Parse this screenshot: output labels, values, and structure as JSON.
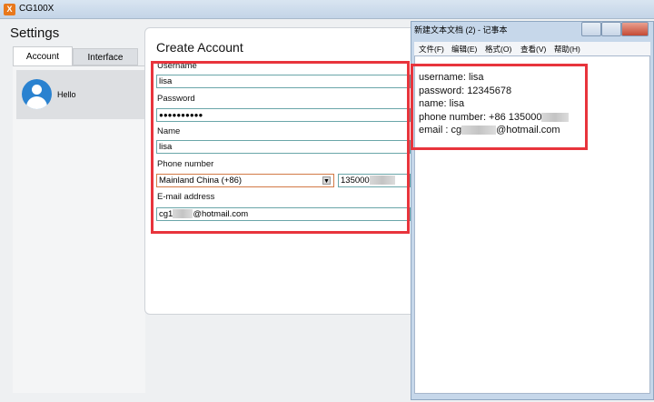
{
  "main": {
    "app_title": "CG100X",
    "logo_glyph": "X",
    "settings_title": "Settings",
    "tabs": [
      {
        "label": "Account"
      },
      {
        "label": "Interface"
      }
    ],
    "account_name": "Hello",
    "accent_color": "#2a82d0"
  },
  "form": {
    "title": "Create Account",
    "username_label": "Username",
    "username_value": "lisa",
    "password_label": "Password",
    "password_value": "●●●●●●●●●●",
    "name_label": "Name",
    "name_value": "lisa",
    "phone_label": "Phone number",
    "country_value": "Mainland China (+86)",
    "phone_value": "135000",
    "email_label": "E-mail address",
    "email_prefix": "cg1",
    "email_suffix": "@hotmail.com"
  },
  "notepad": {
    "title": "新建文本文档 (2) - 记事本",
    "menu": [
      "文件(F)",
      "编辑(E)",
      "格式(O)",
      "查看(V)",
      "帮助(H)"
    ],
    "lines": {
      "username": "username: lisa",
      "password": "password: 12345678",
      "name": "name: lisa",
      "phone": "phone number: +86 135000",
      "email_prefix": "email : cg",
      "email_suffix": "@hotmail.com"
    }
  },
  "highlight_color": "#e8343c"
}
